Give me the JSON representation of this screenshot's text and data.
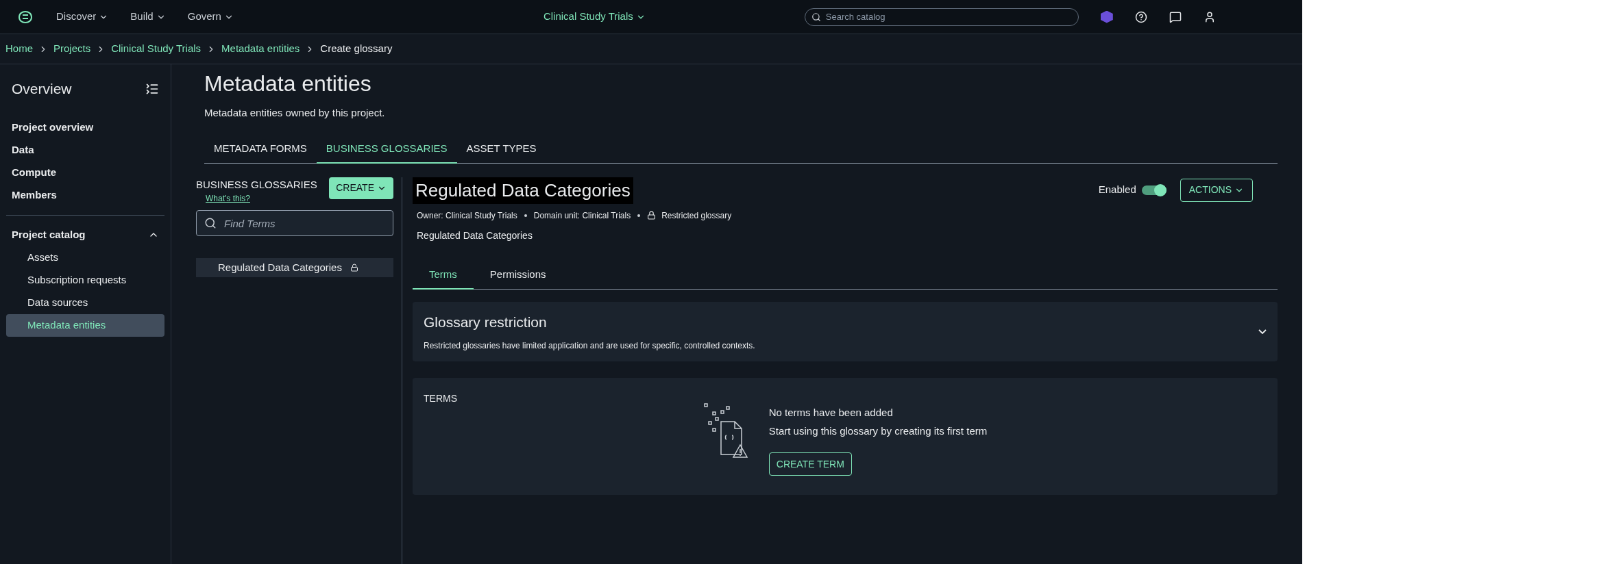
{
  "top_nav": {
    "menus": [
      {
        "label": "Discover"
      },
      {
        "label": "Build"
      },
      {
        "label": "Govern"
      }
    ],
    "project": "Clinical Study Trials",
    "search": {
      "placeholder": "Search catalog"
    }
  },
  "breadcrumbs": [
    {
      "label": "Home",
      "current": false
    },
    {
      "label": "Projects",
      "current": false
    },
    {
      "label": "Clinical Study Trials",
      "current": false
    },
    {
      "label": "Metadata entities",
      "current": false
    },
    {
      "label": "Create glossary",
      "current": true
    }
  ],
  "sidebar": {
    "title": "Overview",
    "items": [
      {
        "label": "Project overview",
        "selected": false
      },
      {
        "label": "Data",
        "selected": false
      },
      {
        "label": "Compute",
        "selected": false
      },
      {
        "label": "Members",
        "selected": false
      }
    ],
    "section": {
      "label": "Project catalog",
      "expanded": true,
      "items": [
        {
          "label": "Assets",
          "selected": false
        },
        {
          "label": "Subscription requests",
          "selected": false
        },
        {
          "label": "Data sources",
          "selected": false
        },
        {
          "label": "Metadata entities",
          "selected": true
        }
      ]
    }
  },
  "page": {
    "title": "Metadata entities",
    "description": "Metadata entities owned by this project.",
    "tabs": [
      {
        "label": "METADATA FORMS",
        "selected": false
      },
      {
        "label": "BUSINESS GLOSSARIES",
        "selected": true
      },
      {
        "label": "ASSET TYPES",
        "selected": false
      }
    ]
  },
  "glossaries": {
    "heading": "BUSINESS GLOSSARIES",
    "help_link": "What's this?",
    "create_button": "CREATE",
    "search": {
      "placeholder": "Find Terms"
    },
    "items": [
      {
        "label": "Regulated Data Categories",
        "locked": true,
        "selected": true
      }
    ]
  },
  "detail": {
    "title": "Regulated Data Categories",
    "owner_label": "Owner:",
    "owner": "Clinical Study Trials",
    "domain_label": "Domain unit:",
    "domain": "Clinical Trials",
    "restriction": "Restricted glossary",
    "description": "Regulated Data Categories",
    "enabled_label": "Enabled",
    "enabled": true,
    "actions": "ACTIONS",
    "tabs": [
      {
        "label": "Terms",
        "selected": true
      },
      {
        "label": "Permissions",
        "selected": false
      }
    ],
    "restriction_panel": {
      "title": "Glossary restriction",
      "text": "Restricted glossaries have limited application and are used for specific, controlled contexts.",
      "expanded": false
    },
    "terms": {
      "heading": "TERMS",
      "empty_title": "No terms have been added",
      "empty_text": "Start using this glossary by creating its first term",
      "button": "CREATE TERM"
    }
  }
}
